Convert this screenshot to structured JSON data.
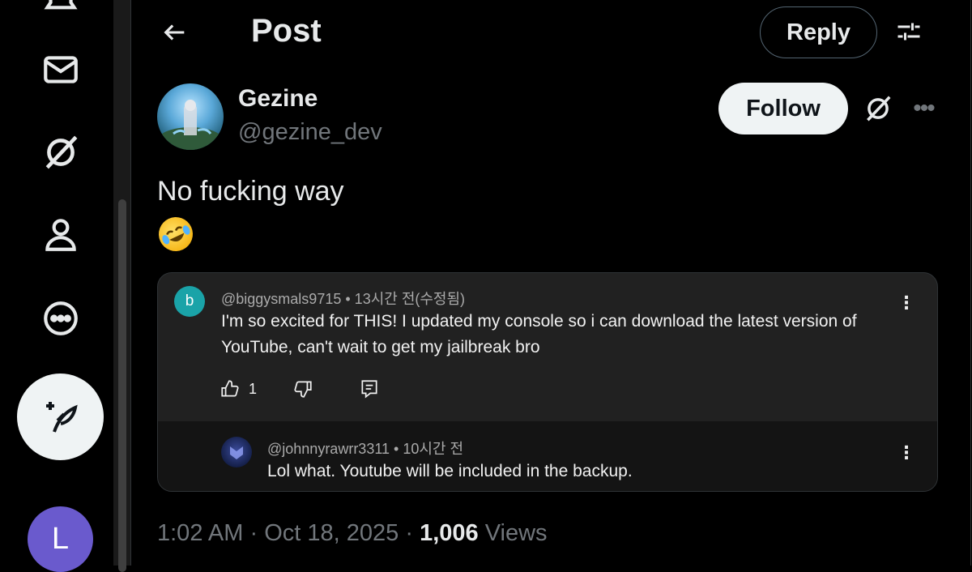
{
  "nav": {
    "items": [
      {
        "name": "notifications-icon"
      },
      {
        "name": "messages-icon"
      },
      {
        "name": "grok-icon"
      },
      {
        "name": "profile-icon"
      },
      {
        "name": "more-icon"
      }
    ],
    "compose_icon": "compose-post-icon",
    "account_initial": "L"
  },
  "header": {
    "title": "Post",
    "reply_label": "Reply",
    "settings_icon": "sliders-icon"
  },
  "author": {
    "name": "Gezine",
    "handle": "@gezine_dev",
    "follow_label": "Follow",
    "more_label": "•••"
  },
  "post": {
    "text": "No fucking way",
    "emoji": "rolling-on-floor-laughing-emoji",
    "time": "1:02 AM",
    "separator1": "·",
    "date": "Oct 18, 2025",
    "separator2": "·",
    "views_count": "1,006",
    "views_label": "Views"
  },
  "screenshot": {
    "comment": {
      "avatar_initial": "b",
      "author": "@biggysmals9715",
      "meta": "• 13시간 전(수정됨)",
      "text": "I'm so excited for THIS! I updated my console so i can download the latest version of YouTube, can't wait to get my jailbreak bro",
      "like_count": "1",
      "kebab": "⋮"
    },
    "reply": {
      "author": "@johnnyrawrr3311",
      "meta": "• 10시간 전",
      "text": "Lol what. Youtube will be included in the backup.",
      "kebab": "⋮"
    }
  },
  "colors": {
    "background": "#000000",
    "text_primary": "#e7e9ea",
    "text_secondary": "#71767b",
    "follow_bg": "#eff3f4",
    "card_bg": "#212121"
  }
}
